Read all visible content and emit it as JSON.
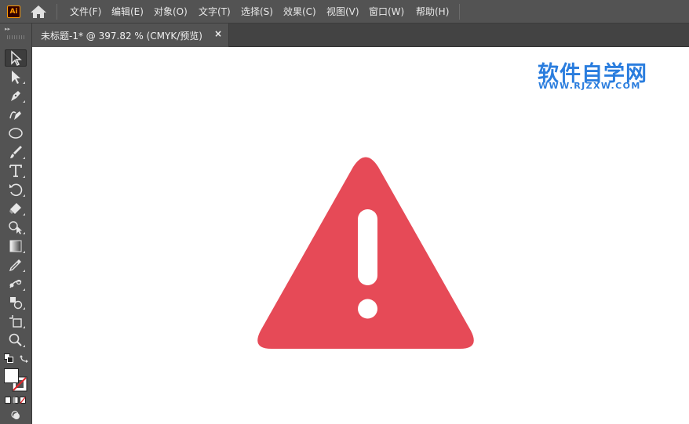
{
  "app": {
    "logo_text": "Ai",
    "home_icon": "home-icon"
  },
  "menu": {
    "items": [
      {
        "label": "文件(F)"
      },
      {
        "label": "编辑(E)"
      },
      {
        "label": "对象(O)"
      },
      {
        "label": "文字(T)"
      },
      {
        "label": "选择(S)"
      },
      {
        "label": "效果(C)"
      },
      {
        "label": "视图(V)"
      },
      {
        "label": "窗口(W)"
      },
      {
        "label": "帮助(H)"
      }
    ]
  },
  "toolbar": {
    "collapse_label": "▸▸",
    "tools": [
      {
        "name": "selection-tool",
        "icon": "arrow-icon",
        "active": true
      },
      {
        "name": "direct-selection-tool",
        "icon": "white-arrow-icon"
      },
      {
        "name": "pen-tool",
        "icon": "pen-icon"
      },
      {
        "name": "curvature-tool",
        "icon": "curvature-pen-icon"
      },
      {
        "name": "ellipse-tool",
        "icon": "ellipse-icon"
      },
      {
        "name": "paintbrush-tool",
        "icon": "brush-icon"
      },
      {
        "name": "type-tool",
        "icon": "type-icon"
      },
      {
        "name": "rotate-tool",
        "icon": "rotate-icon"
      },
      {
        "name": "eraser-tool",
        "icon": "eraser-icon"
      },
      {
        "name": "shape-builder-tool",
        "icon": "shape-builder-icon"
      },
      {
        "name": "gradient-tool",
        "icon": "gradient-icon"
      },
      {
        "name": "eyedropper-tool",
        "icon": "eyedropper-icon"
      },
      {
        "name": "blend-tool",
        "icon": "blend-icon"
      },
      {
        "name": "symbol-sprayer-tool",
        "icon": "symbol-icon"
      },
      {
        "name": "artboard-tool",
        "icon": "artboard-icon"
      },
      {
        "name": "zoom-tool",
        "icon": "zoom-icon"
      }
    ]
  },
  "document": {
    "tab_title": "未标题-1* @ 397.82 % (CMYK/预览)",
    "close_label": "×"
  },
  "watermark": {
    "title": "软件自学网",
    "url": "WWW.RJZXW.COM",
    "color": "#2a7dde"
  },
  "artwork": {
    "icon": "warning-triangle-icon",
    "fill_color": "#e64a57"
  }
}
